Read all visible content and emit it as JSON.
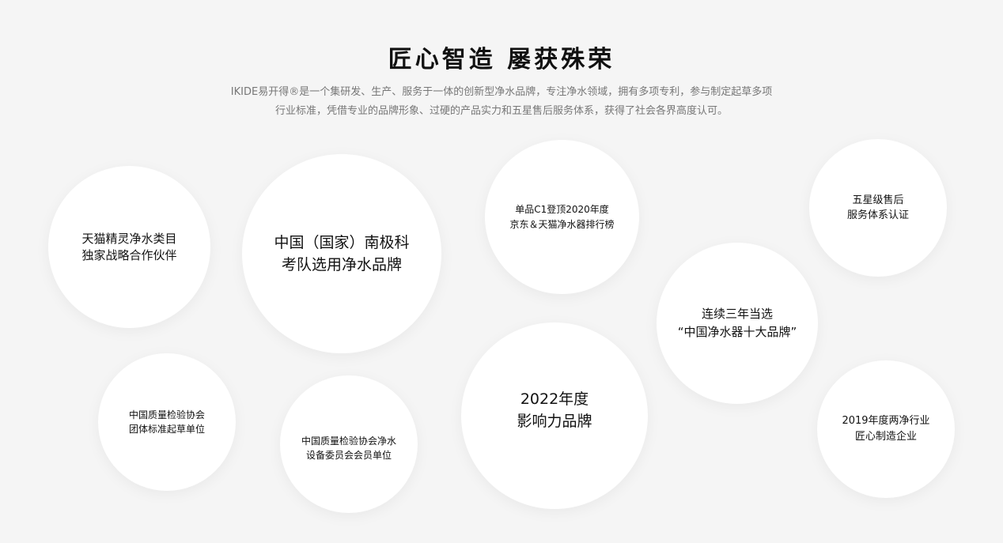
{
  "header": {
    "title": "匠心智造 屡获殊荣",
    "description_lines": [
      "IKIDE易开得®是一个集研发、生产、服务于一体的创新型净水品牌，专注净水领域，拥有多项专利，参与制定起草多项",
      "行业标准，凭借专业的品牌形象、过硬的产品实力和五星售后服务体系，获得了社会各界高度认可。"
    ]
  },
  "honors": [
    {
      "id": "tmall",
      "lines": [
        "天猫精灵净水类目",
        "独家战略合作伙伴"
      ]
    },
    {
      "id": "arctic",
      "lines": [
        "中国（国家）南极科",
        "考队选用净水品牌"
      ]
    },
    {
      "id": "c1",
      "lines": [
        "单品C1登顶2020年度",
        "京东＆天猫净水器排行榜"
      ]
    },
    {
      "id": "five",
      "lines": [
        "五星级售后",
        "服务体系认证"
      ]
    },
    {
      "id": "three",
      "lines": [
        "连续三年当选",
        "“中国净水器十大品牌”"
      ]
    },
    {
      "id": "group",
      "lines": [
        "中国质量检验协会",
        "团体标准起草单位"
      ]
    },
    {
      "id": "member",
      "lines": [
        "中国质量检验协会净水",
        "设备委员会会员单位"
      ]
    },
    {
      "id": "y2022",
      "lines": [
        "2022年度",
        "影响力品牌"
      ]
    },
    {
      "id": "y2019",
      "lines": [
        "2019年度两净行业",
        "匠心制造企业"
      ]
    }
  ],
  "colors": {
    "background": "#f5f5f5",
    "bubble": "#ffffff",
    "title": "#111111",
    "description": "#777777"
  }
}
